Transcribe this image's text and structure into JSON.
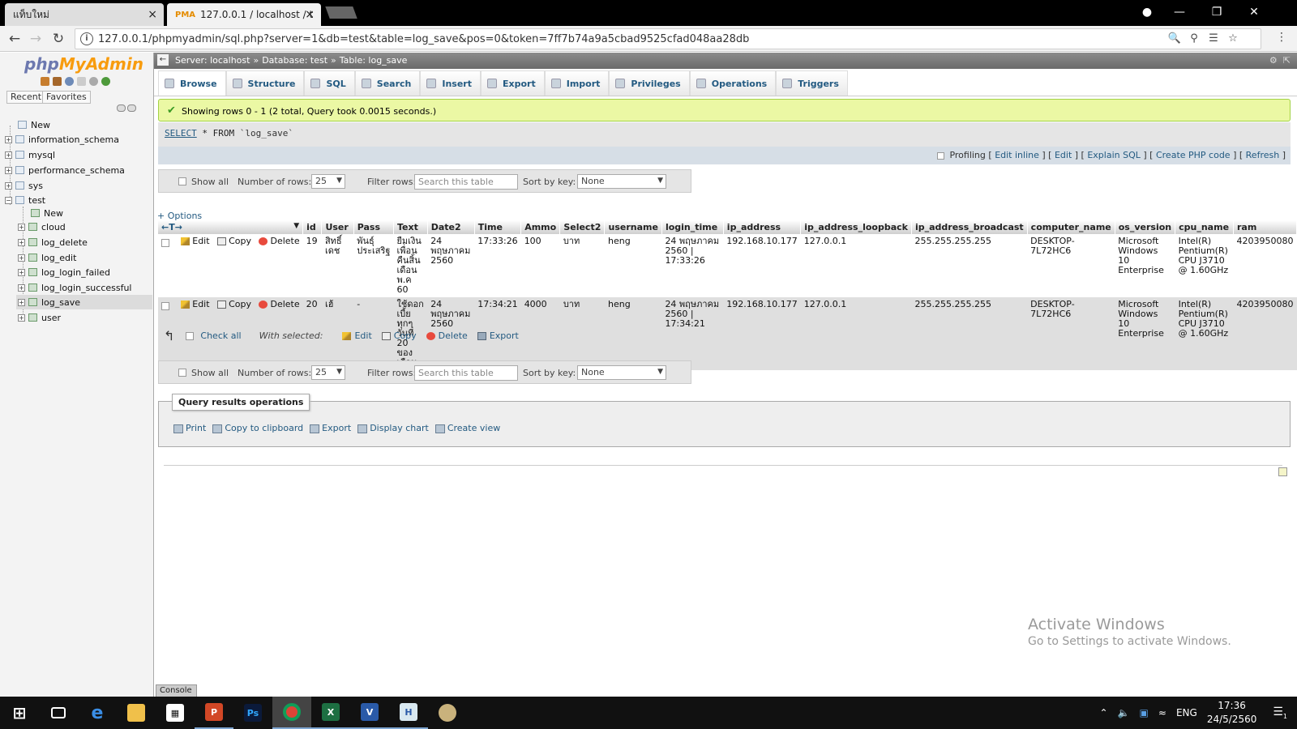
{
  "browser": {
    "tabs": [
      {
        "title": "แท็บใหม่"
      },
      {
        "title": "127.0.0.1 / localhost / tes",
        "favicon": "PMA"
      }
    ],
    "url": "127.0.0.1/phpmyadmin/sql.php?server=1&db=test&table=log_save&pos=0&token=7ff7b74a9a5cbad9525cfad048aa28db"
  },
  "left": {
    "logo_php": "php",
    "logo_myadmin": "MyAdmin",
    "tabs": [
      "Recent",
      "Favorites"
    ],
    "tree": {
      "new": "New",
      "databases": [
        "information_schema",
        "mysql",
        "performance_schema",
        "sys",
        "test"
      ],
      "test_new": "New",
      "tables": [
        "cloud",
        "log_delete",
        "log_edit",
        "log_login_failed",
        "log_login_successful",
        "log_save",
        "user"
      ],
      "active": "log_save"
    }
  },
  "breadcrumb": {
    "server": "Server: localhost",
    "database": "Database: test",
    "table": "Table: log_save",
    "sep": "»"
  },
  "tabs": [
    "Browse",
    "Structure",
    "SQL",
    "Search",
    "Insert",
    "Export",
    "Import",
    "Privileges",
    "Operations",
    "Triggers"
  ],
  "active_tab": "Browse",
  "message": "Showing rows 0 - 1 (2 total, Query took 0.0015 seconds.)",
  "sql": {
    "keyword": "SELECT",
    "rest": "* FROM",
    "table": "`log_save`"
  },
  "sql_links": {
    "profiling": "Profiling",
    "edit_inline": "Edit inline",
    "edit": "Edit",
    "explain": "Explain SQL",
    "php": "Create PHP code",
    "refresh": "Refresh"
  },
  "nav": {
    "show_all": "Show all",
    "rows_label": "Number of rows:",
    "rows_value": "25",
    "filter_label": "Filter rows:",
    "filter_placeholder": "Search this table",
    "sort_label": "Sort by key:",
    "sort_value": "None"
  },
  "options_link": "+ Options",
  "columns": [
    "id",
    "User",
    "Pass",
    "Text",
    "Date2",
    "Time",
    "Ammo",
    "Select2",
    "username",
    "login_time",
    "ip_address",
    "ip_address_loopback",
    "ip_address_broadcast",
    "computer_name",
    "os_version",
    "cpu_name",
    "ram"
  ],
  "row_actions": {
    "edit": "Edit",
    "copy": "Copy",
    "delete": "Delete"
  },
  "rows": [
    {
      "id": "19",
      "User": "สิทธิ์เดช",
      "Pass": "พันธุ์ประเสริฐ",
      "Text": "ยืมเงินเพื่อน คืนสิ้นเดือน พ.ค 60",
      "Date2": "24 พฤษภาคม 2560",
      "Time": "17:33:26",
      "Ammo": "100",
      "Select2": "บาท",
      "username": "heng",
      "login_time": "24 พฤษภาคม 2560 | 17:33:26",
      "ip_address": "192.168.10.177",
      "ip_address_loopback": "127.0.0.1",
      "ip_address_broadcast": "255.255.255.255",
      "computer_name": "DESKTOP-7L72HC6",
      "os_version": "Microsoft Windows 10 Enterprise",
      "cpu_name": "Intel(R) Pentium(R) CPU J3710 @ 1.60GHz",
      "ram": "4203950080"
    },
    {
      "id": "20",
      "User": "เฮ้",
      "Pass": "-",
      "Text": "ใช้ดอกเบี้ยทุกๆ วันที่ 20 ของเดือน",
      "Date2": "24 พฤษภาคม 2560",
      "Time": "17:34:21",
      "Ammo": "4000",
      "Select2": "บาท",
      "username": "heng",
      "login_time": "24 พฤษภาคม 2560 | 17:34:21",
      "ip_address": "192.168.10.177",
      "ip_address_loopback": "127.0.0.1",
      "ip_address_broadcast": "255.255.255.255",
      "computer_name": "DESKTOP-7L72HC6",
      "os_version": "Microsoft Windows 10 Enterprise",
      "cpu_name": "Intel(R) Pentium(R) CPU J3710 @ 1.60GHz",
      "ram": "4203950080"
    }
  ],
  "bulk": {
    "check_all": "Check all",
    "with_selected": "With selected:",
    "edit": "Edit",
    "copy": "Copy",
    "delete": "Delete",
    "export": "Export"
  },
  "qro": {
    "legend": "Query results operations",
    "links": [
      "Print",
      "Copy to clipboard",
      "Export",
      "Display chart",
      "Create view"
    ]
  },
  "watermark": {
    "line1": "Activate Windows",
    "line2": "Go to Settings to activate Windows."
  },
  "console": "Console",
  "taskbar": {
    "lang": "ENG",
    "time": "17:36",
    "date": "24/5/2560",
    "notifications": "1"
  }
}
